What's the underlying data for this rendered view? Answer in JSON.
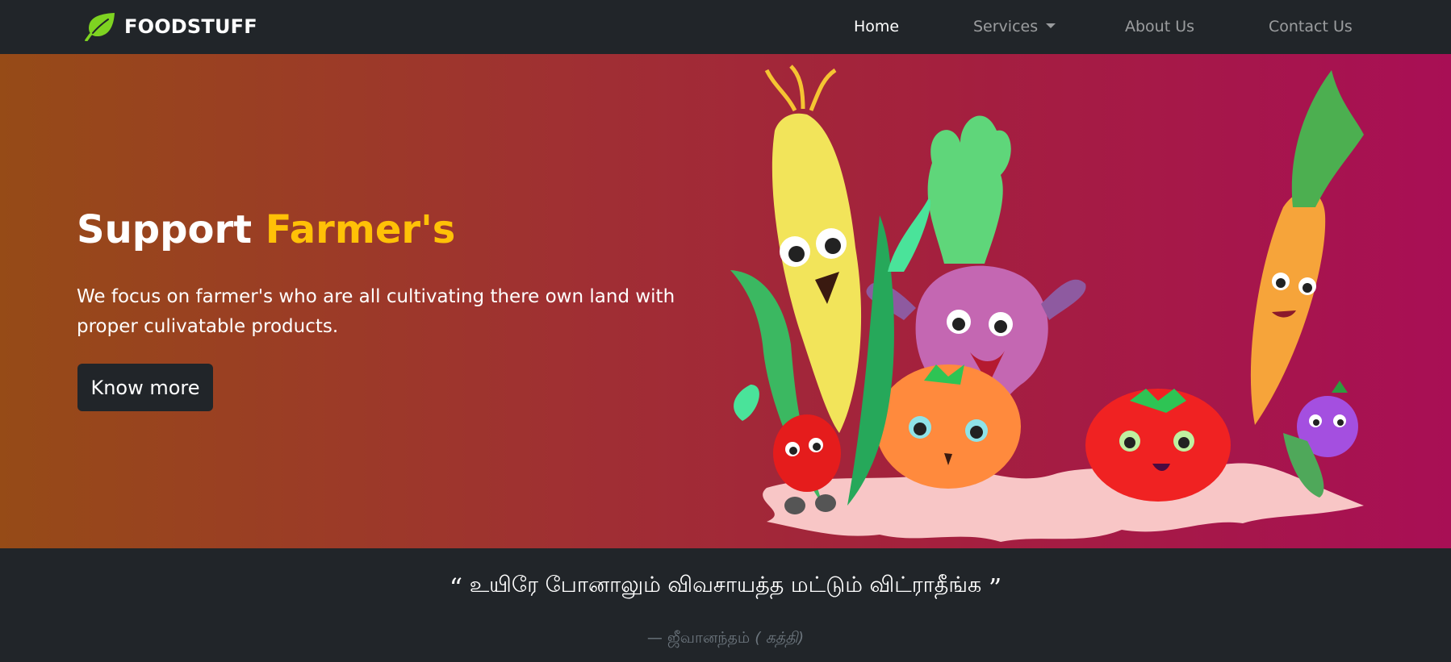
{
  "navbar": {
    "brand": "FOODSTUFF",
    "links": [
      {
        "label": "Home",
        "active": true
      },
      {
        "label": "Services",
        "dropdown": true
      },
      {
        "label": "About Us"
      },
      {
        "label": "Contact Us"
      }
    ]
  },
  "hero": {
    "title_prefix": "Support",
    "title_accent": "Farmer's",
    "description": "We focus on farmer's who are all cultivating there own land with proper culivatable products.",
    "button_label": "Know more",
    "illustration": "cartoon-vegetables"
  },
  "quote": {
    "open_mark": "“",
    "text": "உயிரே போனாலும் விவசாயத்த மட்டும் விட்ராதீங்க",
    "close_mark": "”",
    "dash": "—",
    "author": "ஜீவானந்தம்",
    "source": "( கத்தி)"
  },
  "colors": {
    "navbar_bg": "#212529",
    "accent": "#ffc107",
    "brand_icon": "#7ed321",
    "hero_gradient_start": "#964b17",
    "hero_gradient_end": "#a80f55"
  }
}
